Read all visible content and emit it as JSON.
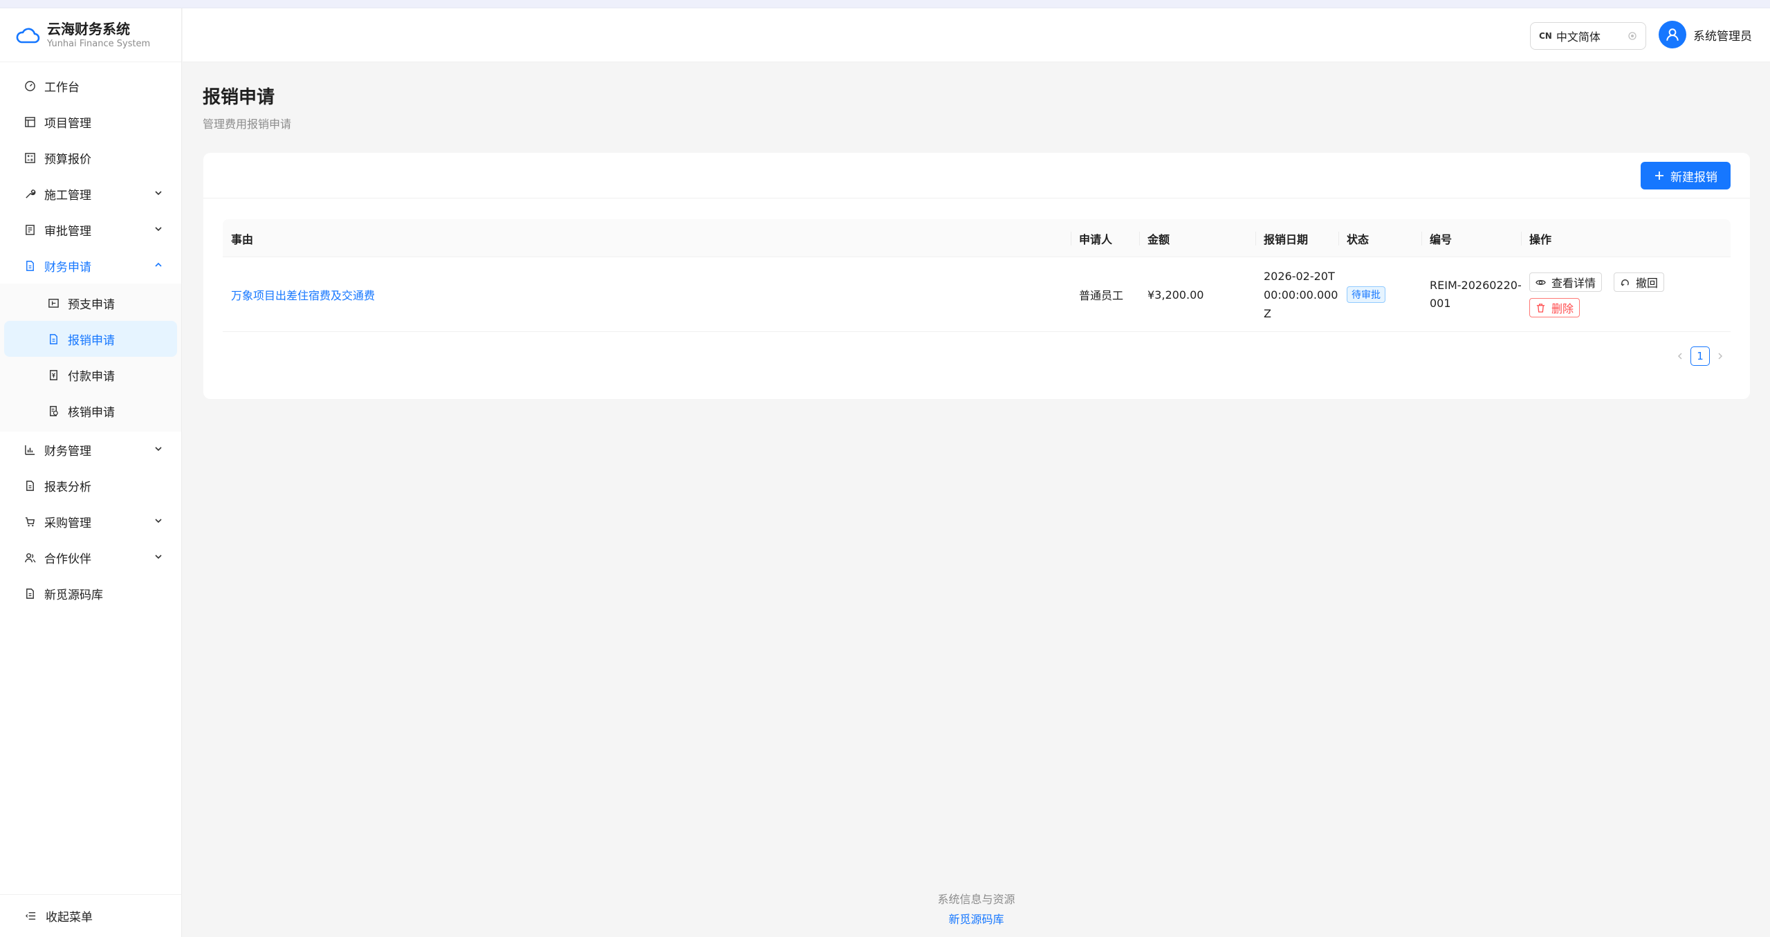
{
  "brand": {
    "title": "云海财务系统",
    "subtitle": "Yunhai Finance System"
  },
  "header": {
    "language": "中文简体",
    "language_code": "CN",
    "user_name": "系统管理员"
  },
  "sidebar": {
    "items": [
      {
        "label": "工作台",
        "icon": "dashboard-icon"
      },
      {
        "label": "项目管理",
        "icon": "project-icon"
      },
      {
        "label": "预算报价",
        "icon": "calculator-icon"
      },
      {
        "label": "施工管理",
        "icon": "tool-icon",
        "expandable": true
      },
      {
        "label": "审批管理",
        "icon": "audit-icon",
        "expandable": true
      },
      {
        "label": "财务申请",
        "icon": "file-icon",
        "expandable": true,
        "open": true,
        "children": [
          {
            "label": "预支申请",
            "icon": "advance-icon"
          },
          {
            "label": "报销申请",
            "icon": "document-icon",
            "active": true
          },
          {
            "label": "付款申请",
            "icon": "payment-icon"
          },
          {
            "label": "核销申请",
            "icon": "writeoff-icon"
          }
        ]
      },
      {
        "label": "财务管理",
        "icon": "bar-chart-icon",
        "expandable": true
      },
      {
        "label": "报表分析",
        "icon": "report-icon"
      },
      {
        "label": "采购管理",
        "icon": "cart-icon",
        "expandable": true
      },
      {
        "label": "合作伙伴",
        "icon": "team-icon",
        "expandable": true
      },
      {
        "label": "新觅源码库",
        "icon": "code-icon"
      }
    ],
    "collapse_label": "收起菜单"
  },
  "page": {
    "title": "报销申请",
    "subtitle": "管理费用报销申请",
    "new_button": "新建报销"
  },
  "table": {
    "columns": [
      "事由",
      "申请人",
      "金额",
      "报销日期",
      "状态",
      "编号",
      "操作"
    ],
    "rows": [
      {
        "reason": "万象项目出差住宿费及交通费",
        "applicant": "普通员工",
        "amount": "¥3,200.00",
        "date": "2026-02-20T00:00:00.000Z",
        "status": "待审批",
        "number": "REIM-20260220-001",
        "actions": {
          "view": "查看详情",
          "withdraw": "撤回",
          "delete": "删除"
        }
      }
    ]
  },
  "pagination": {
    "current": "1"
  },
  "footer": {
    "line1": "系统信息与资源",
    "link": "新觅源码库"
  },
  "colors": {
    "primary": "#1677ff",
    "danger": "#ff4d4f",
    "background": "#f5f5f5"
  }
}
